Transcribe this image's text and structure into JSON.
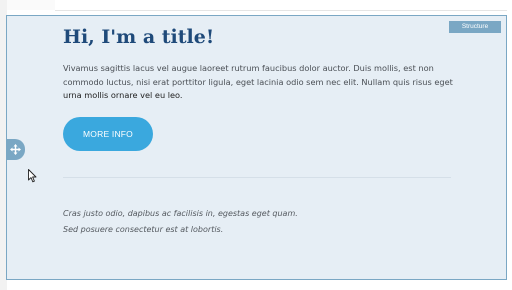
{
  "structure_label": "Structure",
  "content": {
    "title": "Hi, I'm a title!",
    "body_text_regular": "Vivamus sagittis lacus vel augue laoreet rutrum faucibus dolor auctor. Duis mollis, est non commodo luctus, nisi erat porttitor ligula, eget lacinia odio sem nec elit. Nullam quis risus eget ",
    "body_text_emphasis": "urna mollis ornare vel eu leo.",
    "button_label": "MORE INFO",
    "italic_line_1": "Cras justo odio, dapibus ac facilisis in, egestas eget quam.",
    "italic_line_2": "Sed posuere consectetur est at lobortis."
  },
  "icons": {
    "move_handle": "move-arrows-icon",
    "cursor": "mouse-pointer-icon"
  },
  "colors": {
    "panel_background": "#e6eef5",
    "panel_border": "#7aa7c4",
    "title": "#1f4a7a",
    "button": "#3aa8de"
  }
}
